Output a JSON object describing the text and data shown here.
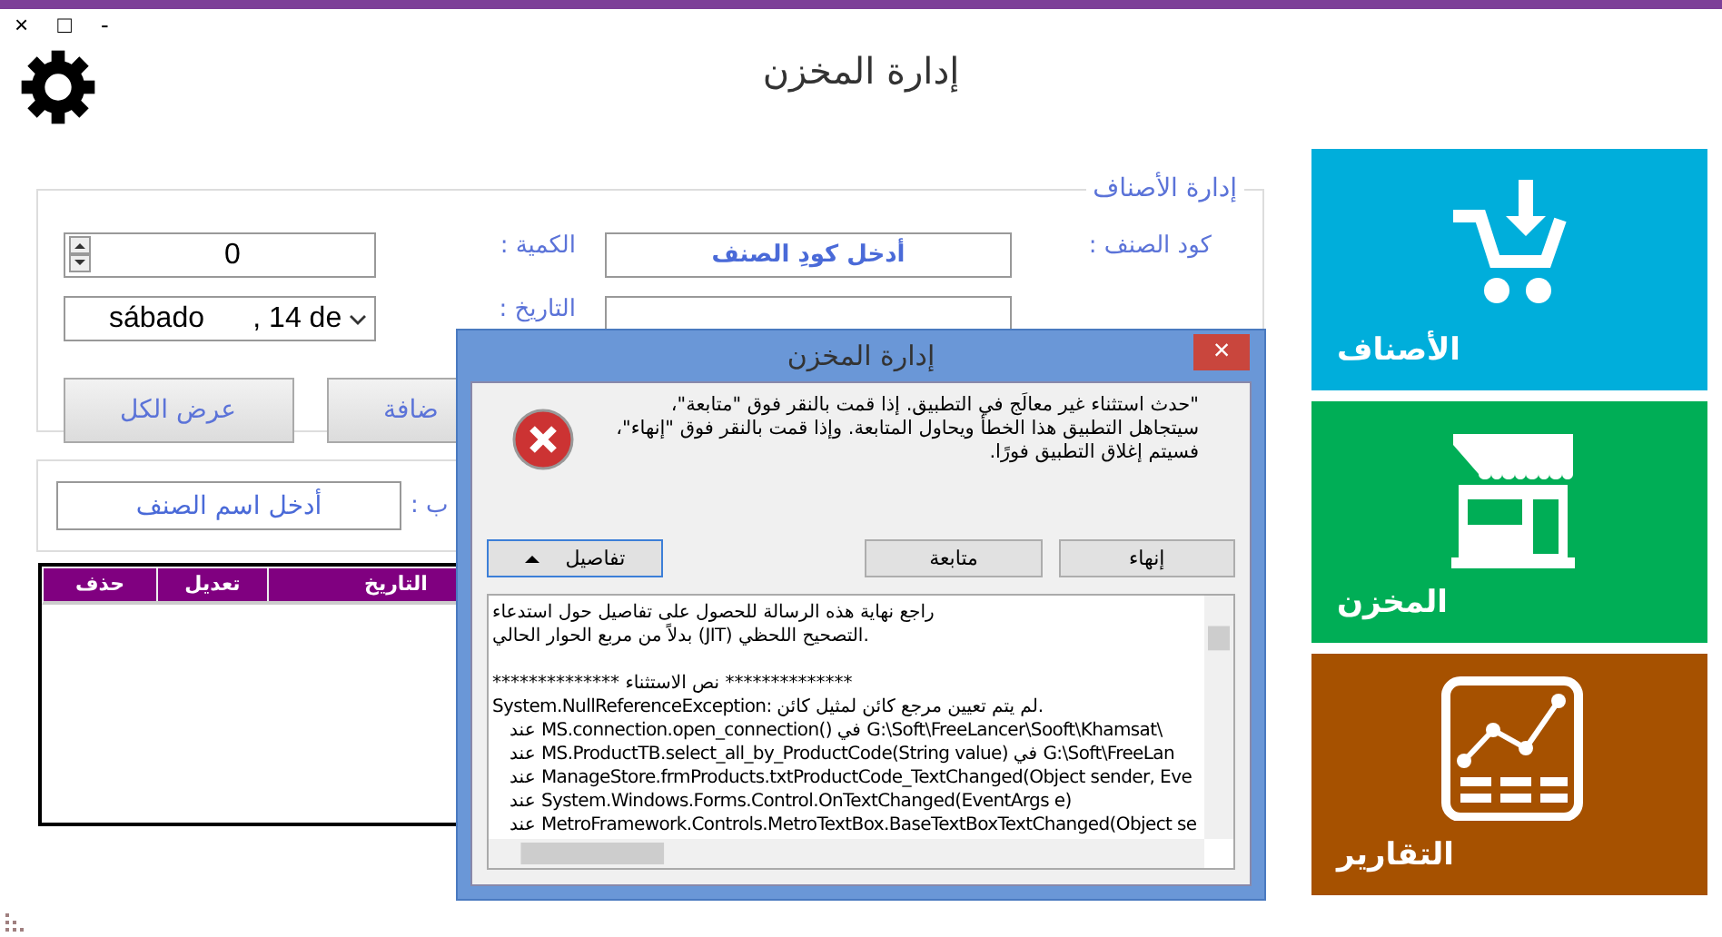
{
  "window": {
    "title": "إدارة المخزن",
    "controls": [
      "-",
      "□",
      "×"
    ]
  },
  "group": {
    "title": "إدارة الأصناف",
    "fields": [
      {
        "kind": "text",
        "label": "كود الصنف :",
        "placeholder": "أدخل كودِ الصنف"
      },
      {
        "kind": "spinner",
        "label": "الكمية :",
        "value": "0"
      },
      {
        "kind": "text"
      },
      {
        "kind": "date",
        "label": "التاريخ :",
        "value": "sábado      , 14 de"
      }
    ],
    "buttons": [
      "ضافة",
      "عرض الكل"
    ]
  },
  "search": {
    "label": "ب :",
    "placeholder": "أدخل اسم الصنف"
  },
  "table": {
    "columns": [
      "التاريخ",
      "تعديل",
      "حذف"
    ]
  },
  "tiles": [
    {
      "kind": "cart",
      "label": "الأصناف",
      "color": "#00aedb"
    },
    {
      "kind": "store",
      "label": "المخزن",
      "color": "#00ae56"
    },
    {
      "kind": "chart",
      "label": "التقارير",
      "color": "#a65100"
    }
  ],
  "dialog": {
    "title": "إدارة المخزن",
    "close": "×",
    "message": "\"حدث استثناء غير معالَج في التطبيق. إذا قمت بالنقر فوق \"متابعة\"، سيتجاهل التطبيق هذا الخطأ ويحاول المتابعة. وإذا قمت بالنقر فوق \"إنهاء\"، فسيتم إغلاق التطبيق فورًا.",
    "buttons": [
      {
        "label": "إنهاء"
      },
      {
        "label": "متابعة"
      },
      {
        "label": "تفاصيل",
        "expanded": true
      }
    ],
    "details": [
      "راجع نهاية هذه الرسالة للحصول على تفاصيل حول استدعاء",
      "بدلاً من مربع الحوار الحالي (JIT) التصحيح اللحظي.",
      "************** نص الاستثناء **************",
      "System.NullReferenceException: لم يتم تعيين مرجع كائن لمثيل كائن.",
      "   عند MS.connection.open_connection() في G:\\Soft\\FreeLancer\\Sooft\\Khamsat\\",
      "   عند MS.ProductTB.select_all_by_ProductCode(String value) في G:\\Soft\\FreeLan",
      "   عند ManageStore.frmProducts.txtProductCode_TextChanged(Object sender, Eve",
      "   عند System.Windows.Forms.Control.OnTextChanged(EventArgs e)",
      "   عند MetroFramework.Controls.MetroTextBox.BaseTextBoxTextChanged(Object se"
    ]
  }
}
